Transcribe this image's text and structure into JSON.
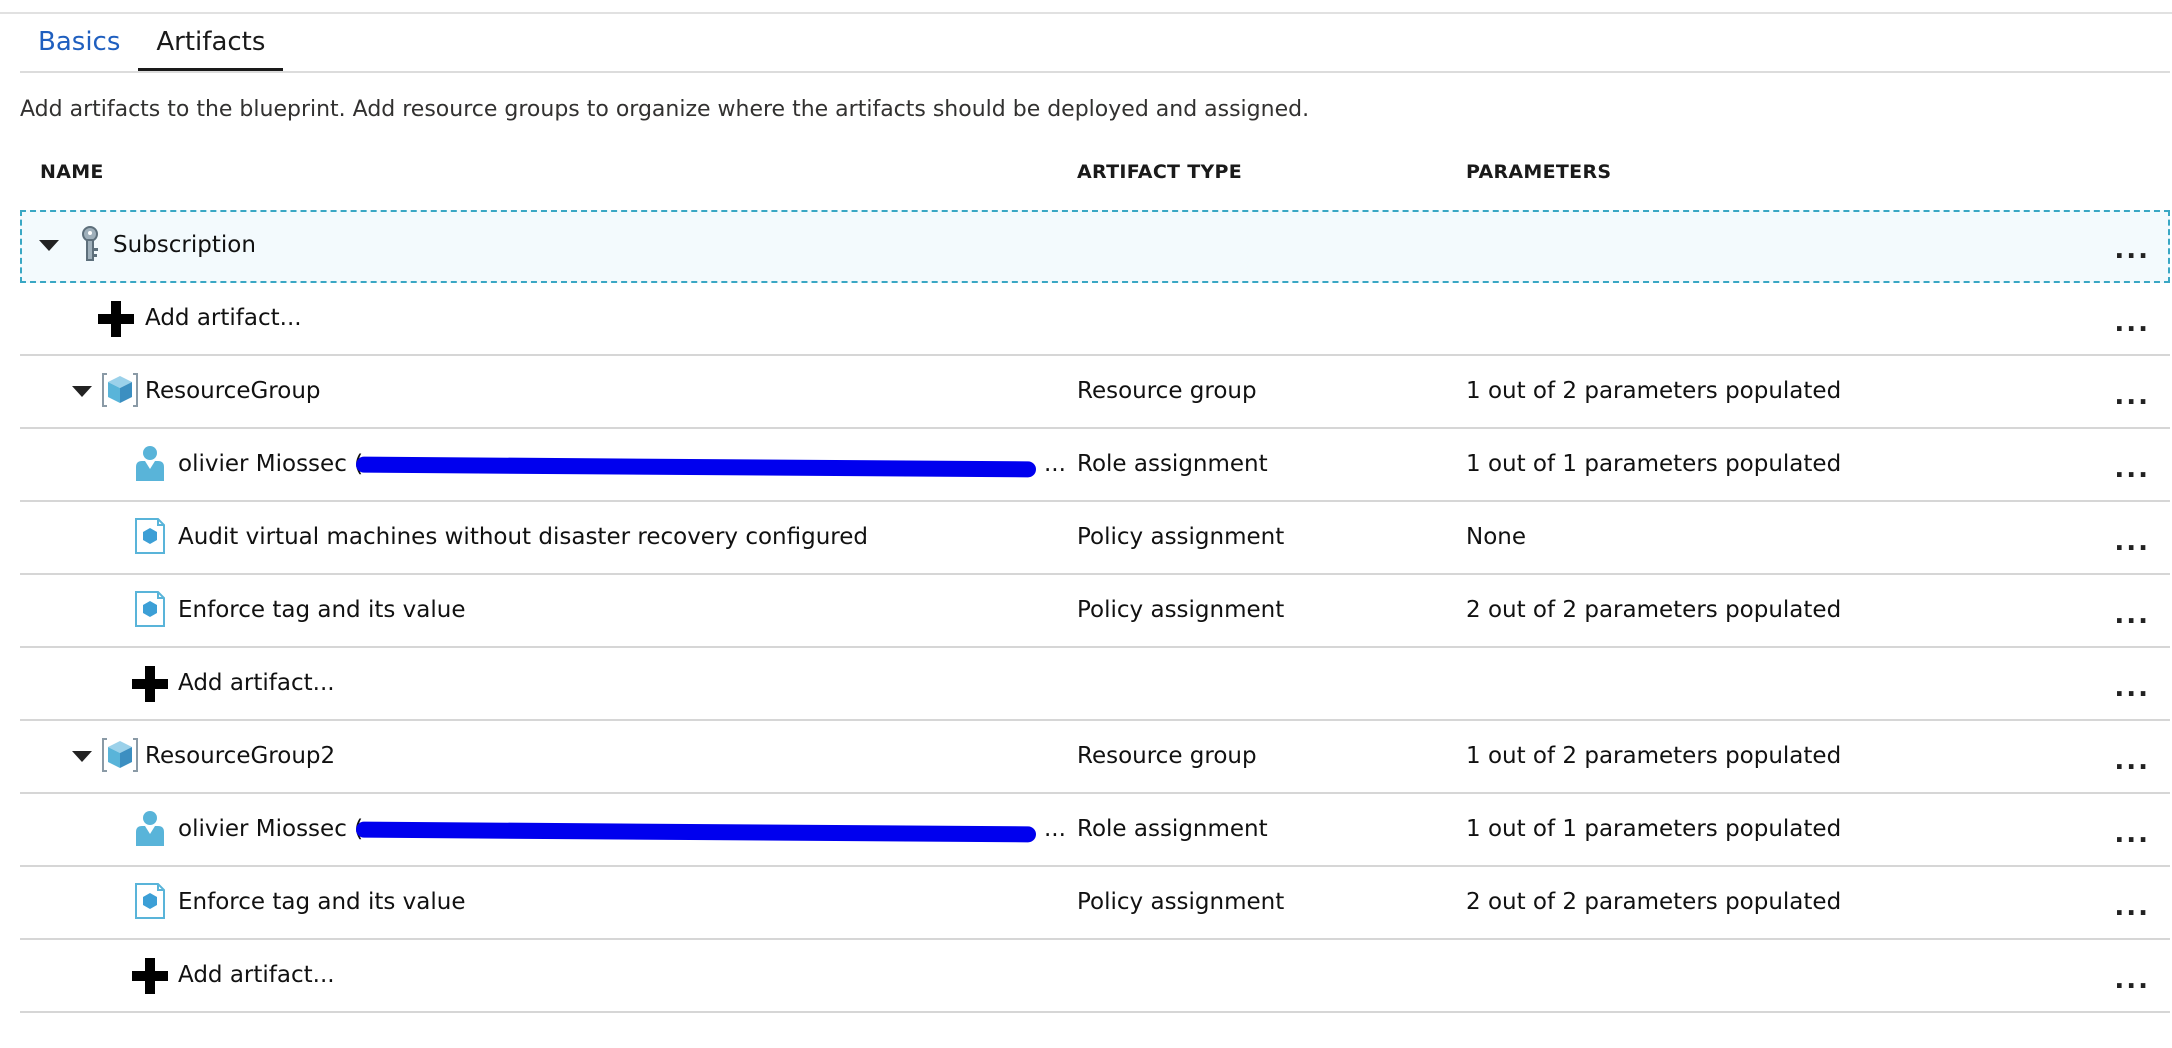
{
  "tabs": [
    {
      "label": "Basics",
      "active": false
    },
    {
      "label": "Artifacts",
      "active": true
    }
  ],
  "description": "Add artifacts to the blueprint. Add resource groups to organize where the artifacts should be deployed and assigned.",
  "columns": {
    "name": "NAME",
    "type": "ARTIFACT TYPE",
    "params": "PARAMETERS"
  },
  "more_label": "...",
  "colors": {
    "tab_link": "#1f5fbf",
    "selection_border": "#39a7c4",
    "selection_bg": "#f3fafd",
    "redaction": "#0000ee",
    "icon_blue": "#59b4d9"
  },
  "rows": [
    {
      "kind": "subscription",
      "name": "Subscription",
      "type": "",
      "params": "",
      "icon": "key-icon",
      "expanded": true,
      "selected": true
    },
    {
      "kind": "add",
      "name": "Add artifact...",
      "type": "",
      "params": "",
      "icon": "plus-icon"
    },
    {
      "kind": "group",
      "name": "ResourceGroup",
      "type": "Resource group",
      "params": "1 out of 2 parameters populated",
      "icon": "resource-group-icon",
      "expanded": true
    },
    {
      "kind": "role",
      "name": "olivier Miossec (",
      "name_suffix": "...",
      "type": "Role assignment",
      "params": "1 out of 1 parameters populated",
      "icon": "user-icon",
      "redacted": true
    },
    {
      "kind": "policy",
      "name": "Audit virtual machines without disaster recovery configured",
      "type": "Policy assignment",
      "params": "None",
      "icon": "policy-icon"
    },
    {
      "kind": "policy",
      "name": "Enforce tag and its value",
      "type": "Policy assignment",
      "params": "2 out of 2 parameters populated",
      "icon": "policy-icon"
    },
    {
      "kind": "add-child",
      "name": "Add artifact...",
      "type": "",
      "params": "",
      "icon": "plus-icon"
    },
    {
      "kind": "group",
      "name": "ResourceGroup2",
      "type": "Resource group",
      "params": "1 out of 2 parameters populated",
      "icon": "resource-group-icon",
      "expanded": true
    },
    {
      "kind": "role",
      "name": "olivier Miossec (",
      "name_suffix": "...",
      "type": "Role assignment",
      "params": "1 out of 1 parameters populated",
      "icon": "user-icon",
      "redacted": true
    },
    {
      "kind": "policy",
      "name": "Enforce tag and its value",
      "type": "Policy assignment",
      "params": "2 out of 2 parameters populated",
      "icon": "policy-icon"
    },
    {
      "kind": "add-child",
      "name": "Add artifact...",
      "type": "",
      "params": "",
      "icon": "plus-icon"
    }
  ]
}
